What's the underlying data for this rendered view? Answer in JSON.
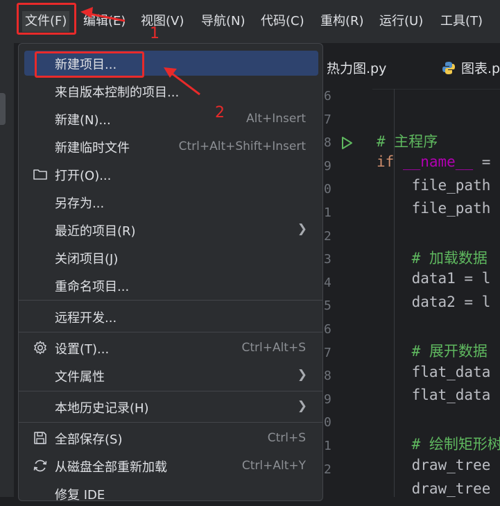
{
  "menubar": {
    "items": [
      {
        "label": "文件(F)"
      },
      {
        "label": "编辑(E)"
      },
      {
        "label": "视图(V)"
      },
      {
        "label": "导航(N)"
      },
      {
        "label": "代码(C)"
      },
      {
        "label": "重构(R)"
      },
      {
        "label": "运行(U)"
      },
      {
        "label": "工具(T)"
      }
    ]
  },
  "annotations": {
    "step1": "1",
    "step2": "2"
  },
  "tabs": [
    {
      "label": "热力图.py"
    },
    {
      "label": "图表.p"
    }
  ],
  "file_menu": {
    "items": [
      {
        "label": "新建项目...",
        "shortcut": ""
      },
      {
        "label": "来自版本控制的项目...",
        "shortcut": ""
      },
      {
        "label": "新建(N)...",
        "shortcut": "Alt+Insert"
      },
      {
        "label": "新建临时文件",
        "shortcut": "Ctrl+Alt+Shift+Insert"
      },
      {
        "label": "打开(O)...",
        "shortcut": ""
      },
      {
        "label": "另存为...",
        "shortcut": ""
      },
      {
        "label": "最近的项目(R)",
        "shortcut": ""
      },
      {
        "label": "关闭项目(J)",
        "shortcut": ""
      },
      {
        "label": "重命名项目...",
        "shortcut": ""
      },
      {
        "label": "远程开发...",
        "shortcut": ""
      },
      {
        "label": "设置(T)...",
        "shortcut": "Ctrl+Alt+S"
      },
      {
        "label": "文件属性",
        "shortcut": ""
      },
      {
        "label": "本地历史记录(H)",
        "shortcut": ""
      },
      {
        "label": "全部保存(S)",
        "shortcut": "Ctrl+S"
      },
      {
        "label": "从磁盘全部重新加载",
        "shortcut": "Ctrl+Alt+Y"
      },
      {
        "label": "修复 IDE",
        "shortcut": ""
      }
    ]
  },
  "editor": {
    "line_numbers": [
      "6",
      "7",
      "8",
      "9",
      "0",
      "1",
      "2",
      "3",
      "4",
      "5",
      "6",
      "7",
      "8",
      "9",
      "0",
      "1",
      "2"
    ],
    "lines": [
      {
        "text": "",
        "cls": ""
      },
      {
        "text": "# 主程序",
        "cls": "cm"
      },
      {
        "text": "if __name__ =",
        "cls": "kwline"
      },
      {
        "text": "    file_path",
        "cls": ""
      },
      {
        "text": "    file_path",
        "cls": ""
      },
      {
        "text": "",
        "cls": ""
      },
      {
        "text": "    # 加载数据",
        "cls": "cm"
      },
      {
        "text": "    data1 = l",
        "cls": ""
      },
      {
        "text": "    data2 = l",
        "cls": ""
      },
      {
        "text": "",
        "cls": ""
      },
      {
        "text": "    # 展开数据",
        "cls": "cm"
      },
      {
        "text": "    flat_data",
        "cls": ""
      },
      {
        "text": "    flat_data",
        "cls": ""
      },
      {
        "text": "",
        "cls": ""
      },
      {
        "text": "    # 绘制矩形树",
        "cls": "cm"
      },
      {
        "text": "    draw_tree",
        "cls": ""
      },
      {
        "text": "    draw_tree",
        "cls": ""
      }
    ]
  },
  "colors": {
    "highlight": "#e82a2a",
    "selection": "#2e436e"
  }
}
